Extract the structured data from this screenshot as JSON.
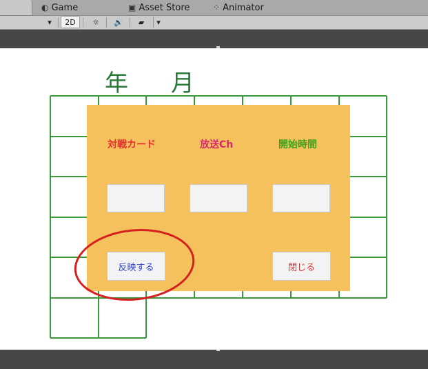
{
  "tabs": {
    "game_label": "Game",
    "asset_store_label": "Asset Store",
    "animator_label": "Animator"
  },
  "toolbar": {
    "mode_2d_label": "2D"
  },
  "schedule": {
    "year_label": "年",
    "month_label": "月"
  },
  "panel": {
    "headers": {
      "matchup": "対戦カード",
      "broadcast_channel": "放送Ch",
      "start_time": "開始時間"
    },
    "inputs": {
      "matchup_value": "",
      "channel_value": "",
      "time_value": ""
    },
    "buttons": {
      "apply_label": "反映する",
      "close_label": "閉じる"
    }
  },
  "colors": {
    "panel_bg": "#f4c15c",
    "grid_line": "#3a9a3a",
    "date_text": "#2a7a3a",
    "header_matchup": "#ea2f2f",
    "header_channel": "#d6296e",
    "header_time": "#3fa11a",
    "apply_text": "#2b3fd6",
    "close_text": "#d93a3a",
    "annotation_circle": "#d42020"
  }
}
